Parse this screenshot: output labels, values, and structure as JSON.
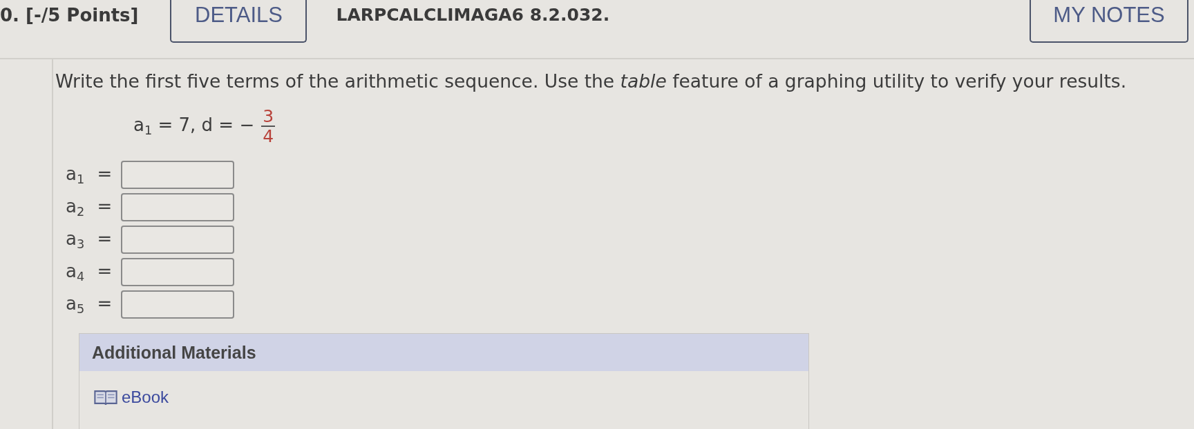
{
  "header": {
    "points": "0. [-/5 Points]",
    "details_button": "DETAILS",
    "problem_id": "LARPCALCLIMAGA6 8.2.032.",
    "notes_button": "MY NOTES"
  },
  "question": {
    "text": "Write the first five terms of the arithmetic sequence. Use the *table* feature of a graphing utility to verify your results.",
    "given": {
      "expression": "a$_{1}$ = 7, d = −",
      "fraction": {
        "numerator": "3",
        "denominator": "4"
      }
    }
  },
  "answers": [
    {
      "label": "a$_{1}$ ="
    },
    {
      "label": "a$_{2}$ ="
    },
    {
      "label": "a$_{3}$ ="
    },
    {
      "label": "a$_{4}$ ="
    },
    {
      "label": "a$_{5}$ ="
    }
  ],
  "additional_materials": {
    "title": "Additional Materials",
    "links": [
      {
        "label": "eBook"
      }
    ]
  }
}
